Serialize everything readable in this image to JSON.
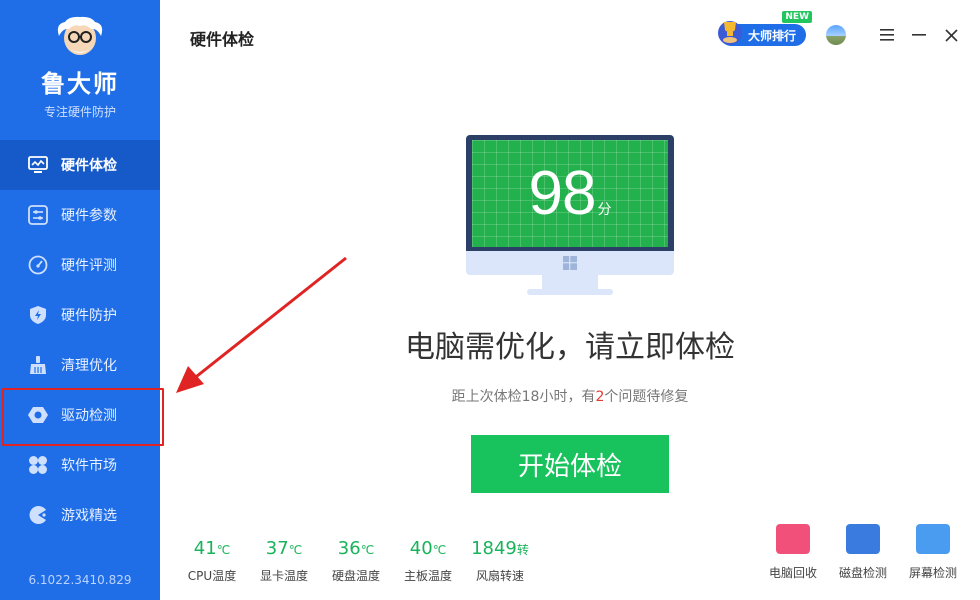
{
  "sidebar": {
    "brand_name": "鲁大师",
    "brand_sub": "专注硬件防护",
    "items": [
      {
        "label": "硬件体检",
        "icon": "monitor-chart-icon"
      },
      {
        "label": "硬件参数",
        "icon": "sliders-icon"
      },
      {
        "label": "硬件评测",
        "icon": "speedometer-icon"
      },
      {
        "label": "硬件防护",
        "icon": "shield-bolt-icon"
      },
      {
        "label": "清理优化",
        "icon": "broom-icon"
      },
      {
        "label": "驱动检测",
        "icon": "gear-hex-icon"
      },
      {
        "label": "软件市场",
        "icon": "grid-blocks-icon"
      },
      {
        "label": "游戏精选",
        "icon": "game-controller-icon"
      }
    ],
    "version": "6.1022.3410.829"
  },
  "header": {
    "title": "硬件体检",
    "rank_label": "大师排行",
    "new_badge": "NEW"
  },
  "main": {
    "score": "98",
    "score_unit": "分",
    "headline": "电脑需优化，请立即体检",
    "sub_prefix": "距上次体检18小时，有",
    "sub_count": "2",
    "sub_suffix": "个问题待修复",
    "start_label": "开始体检"
  },
  "stats": [
    {
      "value": "41",
      "unit": "℃",
      "label": "CPU温度"
    },
    {
      "value": "37",
      "unit": "℃",
      "label": "显卡温度"
    },
    {
      "value": "36",
      "unit": "℃",
      "label": "硬盘温度"
    },
    {
      "value": "40",
      "unit": "℃",
      "label": "主板温度"
    },
    {
      "value": "1849",
      "unit": "转",
      "label": "风扇转速"
    }
  ],
  "tools": [
    {
      "label": "电脑回收",
      "color": "#f0507a",
      "icon": "pig-icon"
    },
    {
      "label": "磁盘检测",
      "color": "#3a7be0",
      "icon": "disk-icon"
    },
    {
      "label": "屏幕检测",
      "color": "#4a9cf0",
      "icon": "screen-icon"
    }
  ],
  "colors": {
    "sidebar": "#1f6ee8",
    "active_item": "#1659c8",
    "accent_green": "#18c25c",
    "highlight_red": "#e02424"
  }
}
